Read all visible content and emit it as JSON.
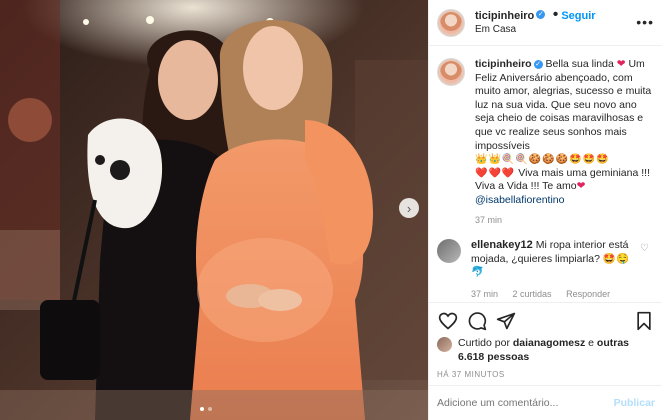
{
  "header": {
    "username": "ticipinheiro",
    "follow_label": "Seguir",
    "separator": "•",
    "location": "Em Casa",
    "more_glyph": "•••"
  },
  "caption": {
    "username": "ticipinheiro",
    "line1": "Bella sua linda",
    "text": "Um Feliz Aniversário abençoado, com muito amor, alegrias, sucesso e muita luz na sua vida. Que seu novo ano seja cheio de coisas maravilhosas e que vc realize seus sonhos mais impossíveis",
    "emojis1": "👑👑🍭🍭🍪🍪🍪🤩🤩🤩",
    "emojis2": "❤️❤️❤️",
    "viva1": "Viva mais uma geminiana !!! Viva a Vida !!! Te amo",
    "mention": "@isabellafiorentino",
    "time": "37 min"
  },
  "comment": {
    "username": "ellenakey12",
    "text": "Mi ropa interior está mojada, ¿quieres limpiarla?",
    "emojis": "🤩🤤",
    "emoji2": "🐬",
    "time": "37 min",
    "likes": "2 curtidas",
    "reply": "Responder"
  },
  "likes": {
    "prefix": "Curtido por",
    "user": "daianagomesz",
    "middle": "e",
    "others": "outras 6.618 pessoas"
  },
  "posted_ago": "HÁ 37 MINUTOS",
  "add_comment": {
    "placeholder": "Adicione um comentário...",
    "publish_label": "Publicar"
  },
  "icons": [
    "heart-icon",
    "comment-icon",
    "share-icon",
    "bookmark-icon",
    "verified-icon",
    "chevron-right-icon"
  ],
  "colors": {
    "link": "#0095f6",
    "heart": "#e0245e",
    "muted": "#8e8e8e",
    "dress_coral": "#f08a5d"
  }
}
